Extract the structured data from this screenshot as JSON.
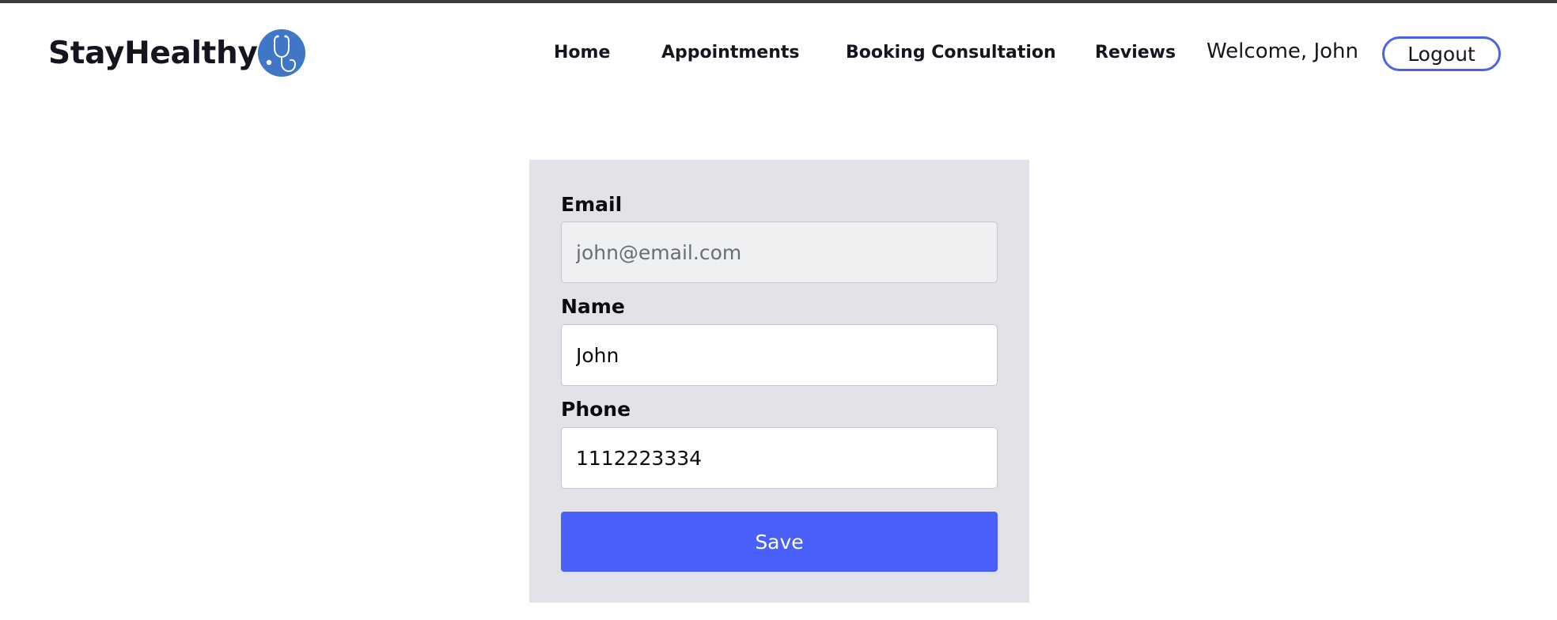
{
  "brand": {
    "name": "StayHealthy",
    "logo_icon": "stethoscope-icon",
    "logo_color": "#3f76c6"
  },
  "nav": {
    "items": [
      {
        "label": "Home"
      },
      {
        "label": "Appointments"
      },
      {
        "label": "Booking Consultation"
      },
      {
        "label": "Reviews"
      }
    ],
    "welcome": "Welcome, John",
    "logout_label": "Logout",
    "accent": "#4a64e6"
  },
  "profile_form": {
    "email": {
      "label": "Email",
      "value": "john@email.com",
      "disabled": true
    },
    "name": {
      "label": "Name",
      "value": "John"
    },
    "phone": {
      "label": "Phone",
      "value": "1112223334"
    },
    "save_label": "Save",
    "save_color": "#4a60fa"
  }
}
